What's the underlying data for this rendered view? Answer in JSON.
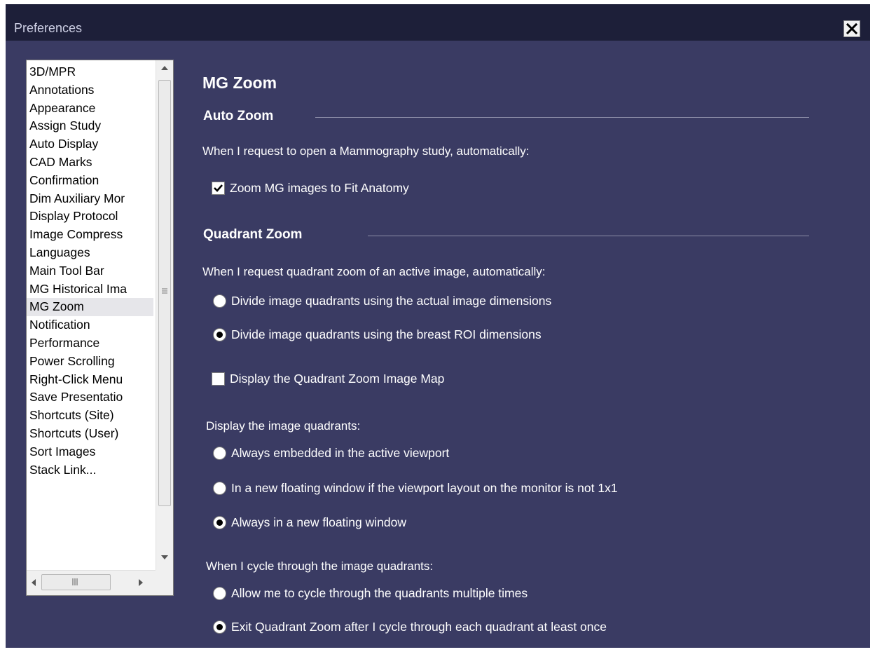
{
  "window": {
    "title": "Preferences",
    "close_glyph": "✕"
  },
  "sidebar": {
    "items": [
      {
        "label": "3D/MPR"
      },
      {
        "label": "Annotations"
      },
      {
        "label": "Appearance"
      },
      {
        "label": "Assign Study"
      },
      {
        "label": "Auto Display"
      },
      {
        "label": "CAD Marks"
      },
      {
        "label": "Confirmation"
      },
      {
        "label": "Dim Auxiliary Mor"
      },
      {
        "label": "Display Protocol"
      },
      {
        "label": "Image Compress"
      },
      {
        "label": "Languages"
      },
      {
        "label": "Main Tool Bar"
      },
      {
        "label": "MG Historical Ima"
      },
      {
        "label": "MG Zoom",
        "selected": true
      },
      {
        "label": "Notification"
      },
      {
        "label": "Performance"
      },
      {
        "label": "Power Scrolling"
      },
      {
        "label": "Right-Click Menu"
      },
      {
        "label": "Save Presentatio"
      },
      {
        "label": "Shortcuts (Site)"
      },
      {
        "label": "Shortcuts (User)"
      },
      {
        "label": "Sort Images"
      },
      {
        "label": "Stack Link..."
      }
    ]
  },
  "main": {
    "title": "MG Zoom",
    "auto_zoom": {
      "heading": "Auto Zoom",
      "description": "When I request to open a Mammography study, automatically:",
      "option_fit_anatomy": {
        "label": "Zoom MG images to Fit Anatomy",
        "checked": true
      }
    },
    "quadrant_zoom": {
      "heading": "Quadrant Zoom",
      "description": "When I request quadrant zoom of an active image, automatically:",
      "divide_options": [
        {
          "label": "Divide image quadrants using the actual image dimensions",
          "selected": false
        },
        {
          "label": "Divide image quadrants using the breast ROI dimensions",
          "selected": true
        }
      ],
      "image_map": {
        "label": "Display the Quadrant Zoom Image Map",
        "checked": false
      },
      "display_heading": "Display the image quadrants:",
      "display_options": [
        {
          "label": "Always embedded in the active viewport",
          "selected": false
        },
        {
          "label": "In a new floating window if the viewport layout on the monitor is not 1x1",
          "selected": false
        },
        {
          "label": "Always in a new floating window",
          "selected": true
        }
      ],
      "cycle_heading": "When I cycle through the image quadrants:",
      "cycle_options": [
        {
          "label": "Allow me to cycle through the quadrants multiple times",
          "selected": false
        },
        {
          "label": "Exit Quadrant Zoom after I cycle through each quadrant at least once",
          "selected": true
        }
      ]
    }
  },
  "icons": {
    "close": "close-icon",
    "check": "checkmark-icon",
    "scroll_up": "arrow-up-icon",
    "scroll_down": "arrow-down-icon",
    "scroll_left": "arrow-left-icon",
    "scroll_right": "arrow-right-icon"
  },
  "colors": {
    "window_bg": "#3a3b63",
    "titlebar_bg": "#1d1f39",
    "text": "#ffffff"
  }
}
